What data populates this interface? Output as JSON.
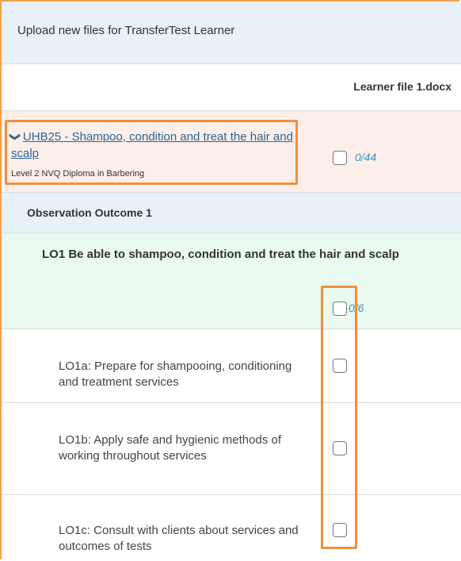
{
  "header": {
    "title": "Upload new files for TransferTest Learner"
  },
  "columns": {
    "file_name": "Learner file 1.docx"
  },
  "unit": {
    "chevron": "❯",
    "title": "UHB25 - Shampoo, condition and treat the hair and scalp",
    "subtitle": "Level 2 NVQ Diploma in Barbering",
    "count": "0/44"
  },
  "observation": {
    "title": "Observation Outcome 1"
  },
  "learning_outcome": {
    "title": "LO1 Be able to shampoo, condition and treat the hair and scalp",
    "count": "0/6"
  },
  "criteria": [
    {
      "label": "LO1a: Prepare for shampooing, conditioning and treatment services"
    },
    {
      "label": "LO1b: Apply safe and hygienic methods of working throughout services"
    },
    {
      "label": "LO1c: Consult with clients about services and outcomes of tests"
    }
  ],
  "colors": {
    "highlight": "#f0903a",
    "link": "#2a6496",
    "count": "#3a8fbf"
  }
}
